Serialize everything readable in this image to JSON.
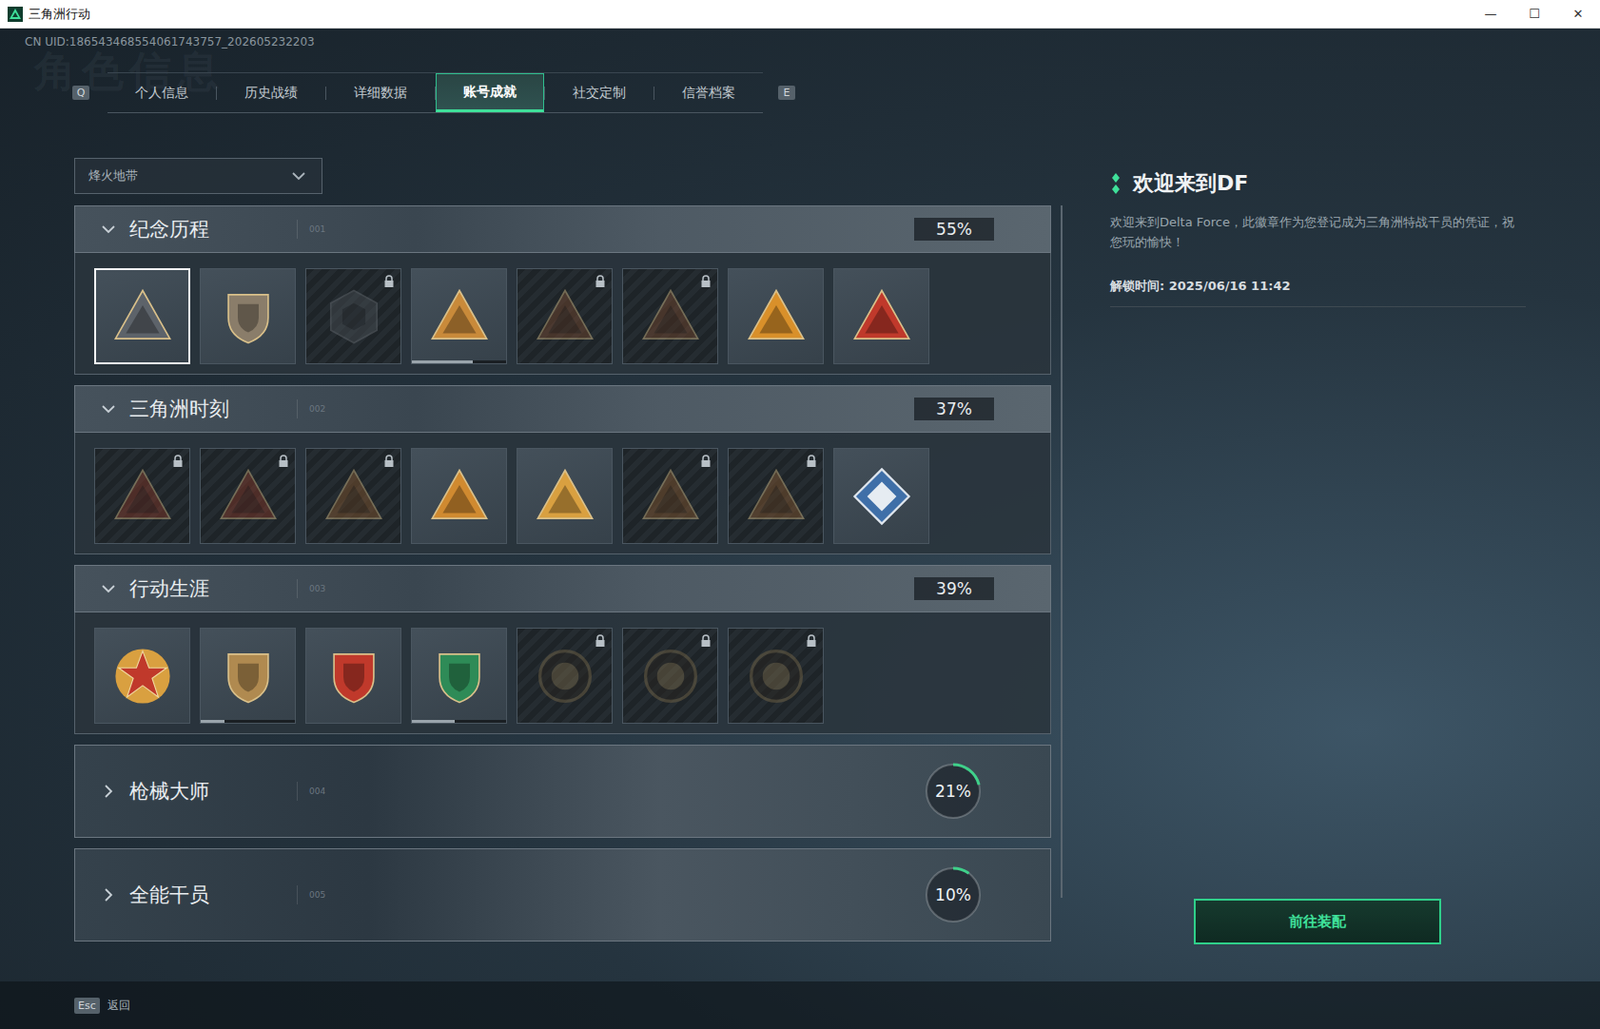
{
  "window": {
    "title": "三角洲行动",
    "controls": [
      "—",
      "☐",
      "✕"
    ]
  },
  "uid": "CN UID:186543468554061743757_202605232203",
  "watermark": "角色信息",
  "tab_keys": {
    "prev": "Q",
    "next": "E"
  },
  "tabs": [
    {
      "label": "个人信息",
      "selected": false
    },
    {
      "label": "历史战绩",
      "selected": false
    },
    {
      "label": "详细数据",
      "selected": false
    },
    {
      "label": "账号成就",
      "selected": true
    },
    {
      "label": "社交定制",
      "selected": false
    },
    {
      "label": "信誉档案",
      "selected": false
    }
  ],
  "mode_select": {
    "value": "烽火地带"
  },
  "sections": [
    {
      "title": "纪念历程",
      "index": "001",
      "percent": "55%",
      "expanded": true,
      "badges": [
        {
          "kind": "triangle",
          "locked": false,
          "selected": true,
          "progress": null,
          "color": "#5d636a"
        },
        {
          "kind": "shield",
          "locked": false,
          "selected": false,
          "progress": null,
          "color": "#8a7d6a"
        },
        {
          "kind": "hexagon",
          "locked": true,
          "selected": false,
          "progress": null,
          "color": "#4a5056"
        },
        {
          "kind": "triangle",
          "locked": false,
          "selected": false,
          "progress": 0.65,
          "color": "#c98a3a"
        },
        {
          "kind": "triangle",
          "locked": true,
          "selected": false,
          "progress": null,
          "color": "#7a4a30"
        },
        {
          "kind": "triangle",
          "locked": true,
          "selected": false,
          "progress": null,
          "color": "#7a4a30"
        },
        {
          "kind": "triangle",
          "locked": false,
          "selected": false,
          "progress": null,
          "color": "#d9902a"
        },
        {
          "kind": "triangle",
          "locked": false,
          "selected": false,
          "progress": null,
          "color": "#c0392b"
        }
      ]
    },
    {
      "title": "三角洲时刻",
      "index": "002",
      "percent": "37%",
      "expanded": true,
      "badges": [
        {
          "kind": "triangle",
          "locked": true,
          "selected": false,
          "progress": null,
          "color": "#8a3a2a"
        },
        {
          "kind": "triangle",
          "locked": true,
          "selected": false,
          "progress": null,
          "color": "#8a3a2a"
        },
        {
          "kind": "triangle",
          "locked": true,
          "selected": false,
          "progress": null,
          "color": "#8a5a30"
        },
        {
          "kind": "triangle",
          "locked": false,
          "selected": false,
          "progress": null,
          "color": "#d08a30"
        },
        {
          "kind": "triangle",
          "locked": false,
          "selected": false,
          "progress": null,
          "color": "#d9a040"
        },
        {
          "kind": "triangle",
          "locked": true,
          "selected": false,
          "progress": null,
          "color": "#8a5a30"
        },
        {
          "kind": "triangle",
          "locked": true,
          "selected": false,
          "progress": null,
          "color": "#8a5a30"
        },
        {
          "kind": "diamond",
          "locked": false,
          "selected": false,
          "progress": null,
          "color": "#3f6fa8"
        }
      ]
    },
    {
      "title": "行动生涯",
      "index": "003",
      "percent": "39%",
      "expanded": true,
      "badges": [
        {
          "kind": "star",
          "locked": false,
          "selected": false,
          "progress": null,
          "color": "#c0392b"
        },
        {
          "kind": "shield",
          "locked": false,
          "selected": false,
          "progress": 0.25,
          "color": "#b08a50"
        },
        {
          "kind": "shield",
          "locked": false,
          "selected": false,
          "progress": null,
          "color": "#c0392b"
        },
        {
          "kind": "shield",
          "locked": false,
          "selected": false,
          "progress": 0.45,
          "color": "#2e8b57"
        },
        {
          "kind": "medal",
          "locked": true,
          "selected": false,
          "progress": null,
          "color": "#7a6a4a"
        },
        {
          "kind": "medal",
          "locked": true,
          "selected": false,
          "progress": null,
          "color": "#7a6a4a"
        },
        {
          "kind": "medal",
          "locked": true,
          "selected": false,
          "progress": null,
          "color": "#7a6a4a"
        }
      ]
    },
    {
      "title": "枪械大师",
      "index": "004",
      "percent": "21%",
      "expanded": false,
      "level": 0.21,
      "badges": []
    },
    {
      "title": "全能干员",
      "index": "005",
      "percent": "10%",
      "expanded": false,
      "level": 0.1,
      "badges": []
    }
  ],
  "detail": {
    "title": "欢迎来到DF",
    "description": "欢迎来到Delta Force，此徽章作为您登记成为三角洲特战干员的凭证，祝您玩的愉快！",
    "unlock": "解锁时间: 2025/06/16 11:42",
    "button": "前往装配"
  },
  "footer": {
    "key": "Esc",
    "label": "返回"
  }
}
